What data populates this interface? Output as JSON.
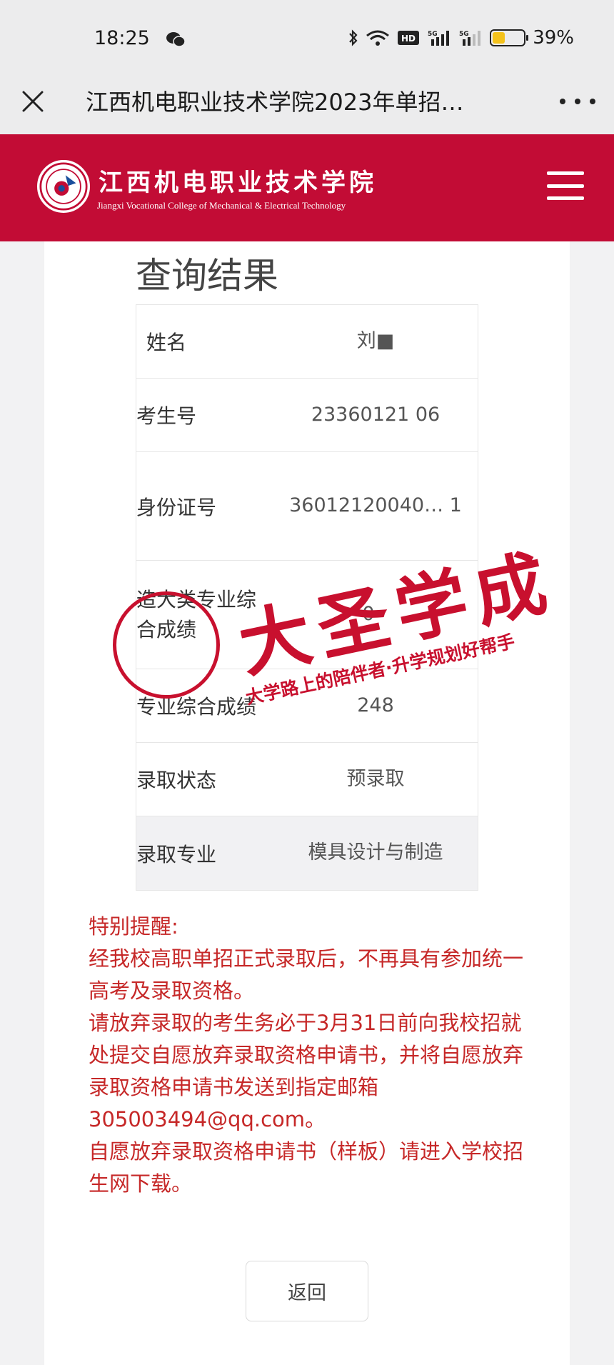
{
  "status_bar": {
    "time": "18:25",
    "battery": "39%",
    "battery_level": 0.39,
    "icons": [
      "wechat-icon",
      "bluetooth-icon",
      "wifi-icon",
      "hd-icon",
      "signal-5g-icon",
      "signal-5g-icon",
      "battery-icon"
    ]
  },
  "title_bar": {
    "title": "江西机电职业技术学院2023年单招…"
  },
  "site_header": {
    "college_name_cn": "江西机电职业技术学院",
    "college_name_en": "Jiangxi Vocational College of Mechanical & Electrical Technology",
    "brand_color": "#c20c35"
  },
  "page": {
    "title": "查询结果"
  },
  "results": [
    {
      "label": "姓名",
      "value": "刘■"
    },
    {
      "label": "考生号",
      "value": "23360121  06"
    },
    {
      "label": "身份证号",
      "value": "36012120040… 1"
    },
    {
      "label": "造大类专业综合成绩",
      "value": "0"
    },
    {
      "label": "专业综合成绩",
      "value": "248"
    },
    {
      "label": "录取状态",
      "value": "预录取"
    },
    {
      "label": "录取专业",
      "value": "模具设计与制造"
    }
  ],
  "notice": {
    "heading": "特别提醒:",
    "p1": "经我校高职单招正式录取后，不再具有参加统一高考及录取资格。",
    "p2": "请放弃录取的考生务必于3月31日前向我校招就处提交自愿放弃录取资格申请书，并将自愿放弃录取资格申请书发送到指定邮箱305003494@qq.com。",
    "p3": "自愿放弃录取资格申请书（样板）请进入学校招生网下载。",
    "color": "#c62828"
  },
  "back_button": {
    "label": "返回"
  },
  "watermark": {
    "big": "大圣学成",
    "sub": "大学路上的陪伴者·升学规划好帮手",
    "color": "#c8102e"
  }
}
